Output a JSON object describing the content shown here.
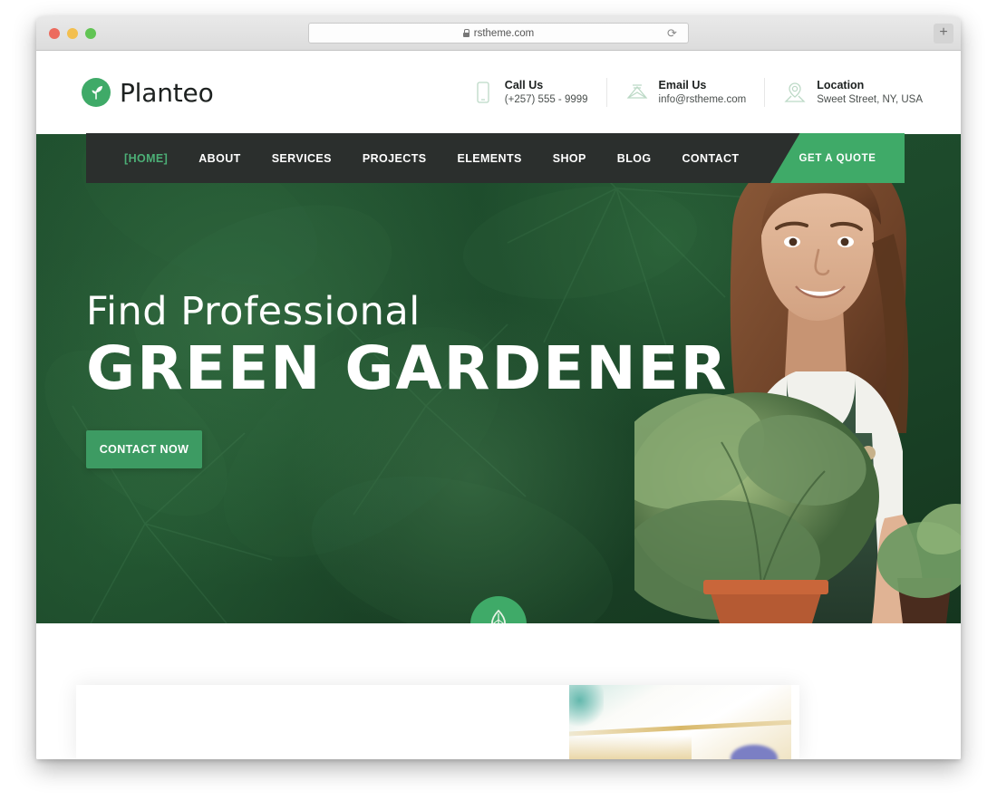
{
  "browser": {
    "url": "rstheme.com",
    "lock_icon": "lock-icon",
    "reload_icon": "reload-icon",
    "newtab_label": "+",
    "traffic_lights": [
      "close-red",
      "minimize-yellow",
      "maximize-green"
    ]
  },
  "site": {
    "logo": {
      "text": "Planteo",
      "icon": "leaf-logo-icon",
      "accent_color": "#3faa68"
    },
    "contacts": [
      {
        "icon": "phone-icon",
        "title": "Call Us",
        "value": "(+257) 555 - 9999"
      },
      {
        "icon": "envelope-icon",
        "title": "Email Us",
        "value": "info@rstheme.com"
      },
      {
        "icon": "map-pin-icon",
        "title": "Location",
        "value": "Sweet Street, NY, USA"
      }
    ],
    "nav": {
      "items": [
        {
          "label": "[HOME]",
          "active": true
        },
        {
          "label": "ABOUT",
          "active": false
        },
        {
          "label": "SERVICES",
          "active": false
        },
        {
          "label": "PROJECTS",
          "active": false
        },
        {
          "label": "ELEMENTS",
          "active": false
        },
        {
          "label": "SHOP",
          "active": false
        },
        {
          "label": "BLOG",
          "active": false
        },
        {
          "label": "CONTACT",
          "active": false
        }
      ],
      "quote_button": "GET A QUOTE",
      "bar_color": "#2b2f2d",
      "active_color": "#4caf76"
    },
    "hero": {
      "subtitle": "Find Professional",
      "title": "GREEN GARDENER",
      "cta_label": "CONTACT NOW",
      "badge_icon": "leaf-icon",
      "background_color": "#1d4a2b",
      "image_alt": "woman gardener holding potted plants"
    }
  }
}
